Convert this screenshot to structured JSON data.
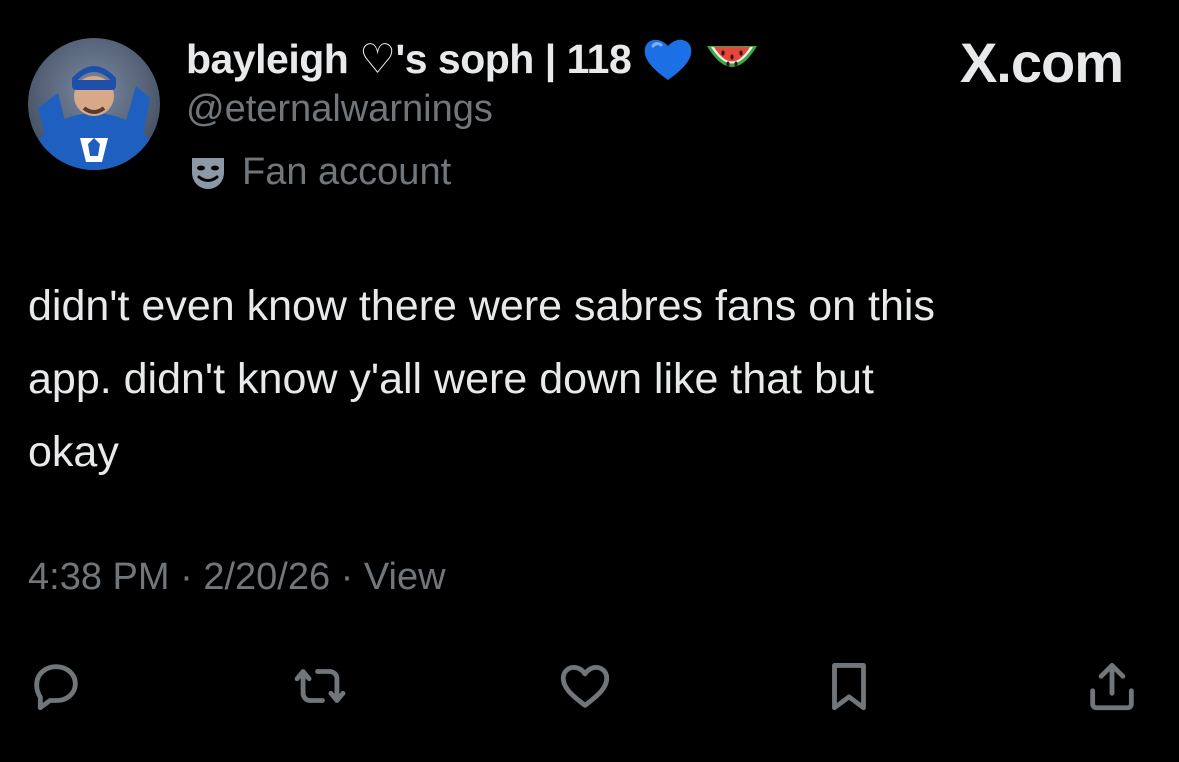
{
  "user": {
    "display_name": "bayleigh ♡'s soph | 118",
    "emojis": [
      "blue-heart-icon",
      "watermelon-icon"
    ],
    "handle": "@eternalwarnings",
    "affiliation_icon": "performing-arts-mask-icon",
    "affiliation": "Fan account"
  },
  "brand": "X.com",
  "post": {
    "text": "didn't even know there were sabres fans on this\napp. didn't know y'all were down like that but\nokay",
    "time": "4:38 PM",
    "date": "2/20/26",
    "views_label": "View",
    "separator": " · "
  },
  "actions": [
    {
      "name": "reply",
      "icon": "reply-icon"
    },
    {
      "name": "repost",
      "icon": "repost-icon"
    },
    {
      "name": "like",
      "icon": "heart-icon"
    },
    {
      "name": "bookmark",
      "icon": "bookmark-icon"
    },
    {
      "name": "share",
      "icon": "share-icon"
    }
  ],
  "colors": {
    "background": "#000000",
    "primary_text": "#e7e9ea",
    "secondary_text": "#71767b",
    "heart_emoji": "#1d6fe6",
    "watermelon_rind": "#3aa845",
    "watermelon_flesh": "#e8453c",
    "avatar_jersey": "#1f5fbf"
  }
}
